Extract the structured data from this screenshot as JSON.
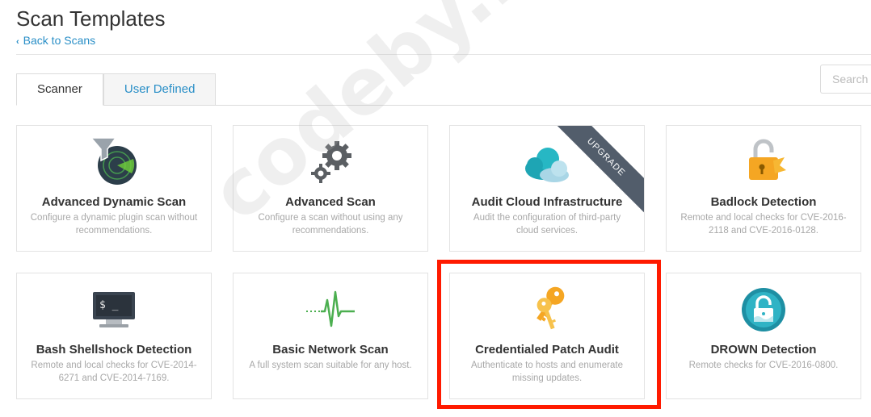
{
  "header": {
    "title": "Scan Templates",
    "back_label": "Back to Scans"
  },
  "tabs": [
    {
      "label": "Scanner",
      "active": true
    },
    {
      "label": "User Defined",
      "active": false
    }
  ],
  "search": {
    "placeholder": "Search"
  },
  "templates": [
    {
      "title": "Advanced Dynamic Scan",
      "desc": "Configure a dynamic plugin scan without recommendations.",
      "icon": "radar-funnel-icon"
    },
    {
      "title": "Advanced Scan",
      "desc": "Configure a scan without using any recommendations.",
      "icon": "gears-icon"
    },
    {
      "title": "Audit Cloud Infrastructure",
      "desc": "Audit the configuration of third-party cloud services.",
      "icon": "cloud-icon",
      "badge": "UPGRADE"
    },
    {
      "title": "Badlock Detection",
      "desc": "Remote and local checks for CVE-2016-2118 and CVE-2016-0128.",
      "icon": "broken-lock-icon"
    },
    {
      "title": "Bash Shellshock Detection",
      "desc": "Remote and local checks for CVE-2014-6271 and CVE-2014-7169.",
      "icon": "terminal-monitor-icon"
    },
    {
      "title": "Basic Network Scan",
      "desc": "A full system scan suitable for any host.",
      "icon": "pulse-icon"
    },
    {
      "title": "Credentialed Patch Audit",
      "desc": "Authenticate to hosts and enumerate missing updates.",
      "icon": "keys-icon"
    },
    {
      "title": "DROWN Detection",
      "desc": "Remote checks for CVE-2016-0800.",
      "icon": "drown-lock-icon"
    }
  ],
  "colors": {
    "accent": "#2a8fc7",
    "highlight": "#ff1a00",
    "ribbon": "#525d6b"
  },
  "watermark": "codeby.net"
}
